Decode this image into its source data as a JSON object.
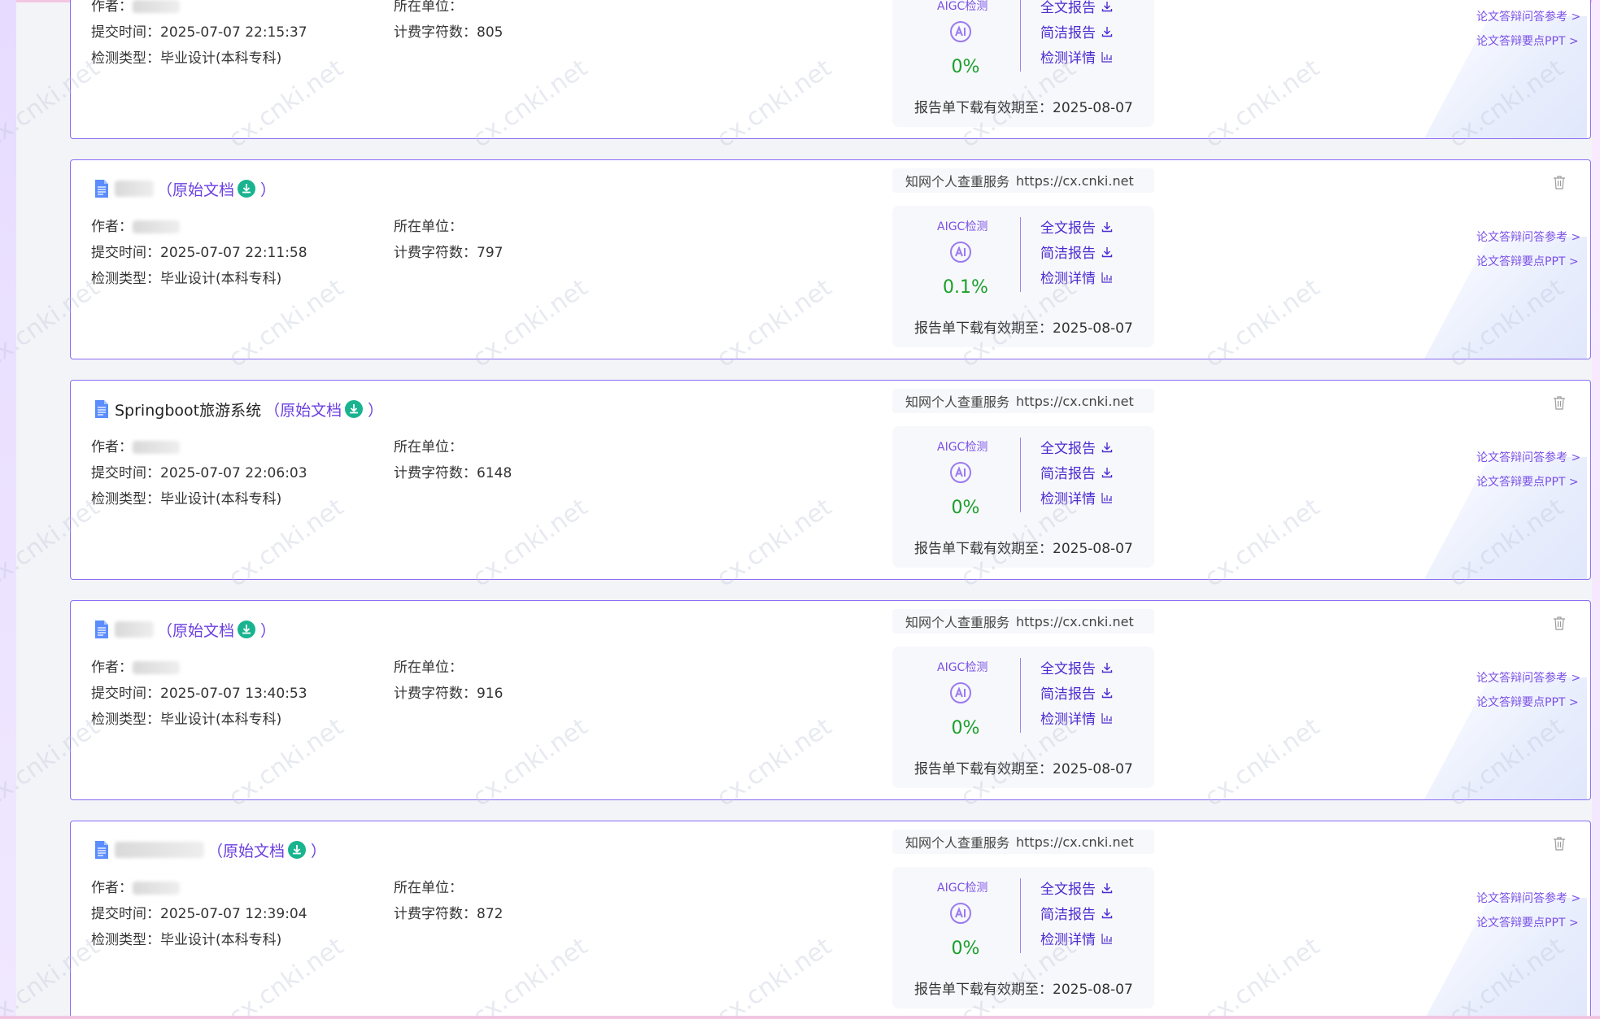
{
  "card_labels": {
    "original_doc": "（原始文档",
    "original_close": "）",
    "author_label": "作者：",
    "unit_label": "所在单位：",
    "submit_label": "提交时间：",
    "chars_label": "计费字符数：",
    "type_label": "检测类型：",
    "service_name": "知网个人查重服务",
    "service_url": "https://cx.cnki.net",
    "aigc_label": "AIGC检测",
    "full_report": "全文报告",
    "brief_report": "简洁报告",
    "detail": "检测详情",
    "expiry_label": "报告单下载有效期至：",
    "side_link_1": "论文答辩问答参考 >",
    "side_link_2": "论文答辩要点PPT >"
  },
  "watermark_text": "cx.cnki.net",
  "colors": {
    "accent": "#6b3fe0",
    "card_border": "#8b6cf5",
    "percent_green": "#1aa02a",
    "download_green": "#19b48f"
  },
  "records": [
    {
      "title": "",
      "submit_time": "2025-07-07 22:15:37",
      "chars": "805",
      "check_type": "毕业设计(本科专科)",
      "aigc_percent": "0%",
      "expiry": "2025-08-07"
    },
    {
      "title": "",
      "submit_time": "2025-07-07 22:11:58",
      "chars": "797",
      "check_type": "毕业设计(本科专科)",
      "aigc_percent": "0.1%",
      "expiry": "2025-08-07"
    },
    {
      "title": "Springboot旅游系统",
      "submit_time": "2025-07-07 22:06:03",
      "chars": "6148",
      "check_type": "毕业设计(本科专科)",
      "aigc_percent": "0%",
      "expiry": "2025-08-07"
    },
    {
      "title": "",
      "submit_time": "2025-07-07 13:40:53",
      "chars": "916",
      "check_type": "毕业设计(本科专科)",
      "aigc_percent": "0%",
      "expiry": "2025-08-07"
    },
    {
      "title": "",
      "submit_time": "2025-07-07 12:39:04",
      "chars": "872",
      "check_type": "毕业设计(本科专科)",
      "aigc_percent": "0%",
      "expiry": "2025-08-07"
    }
  ]
}
